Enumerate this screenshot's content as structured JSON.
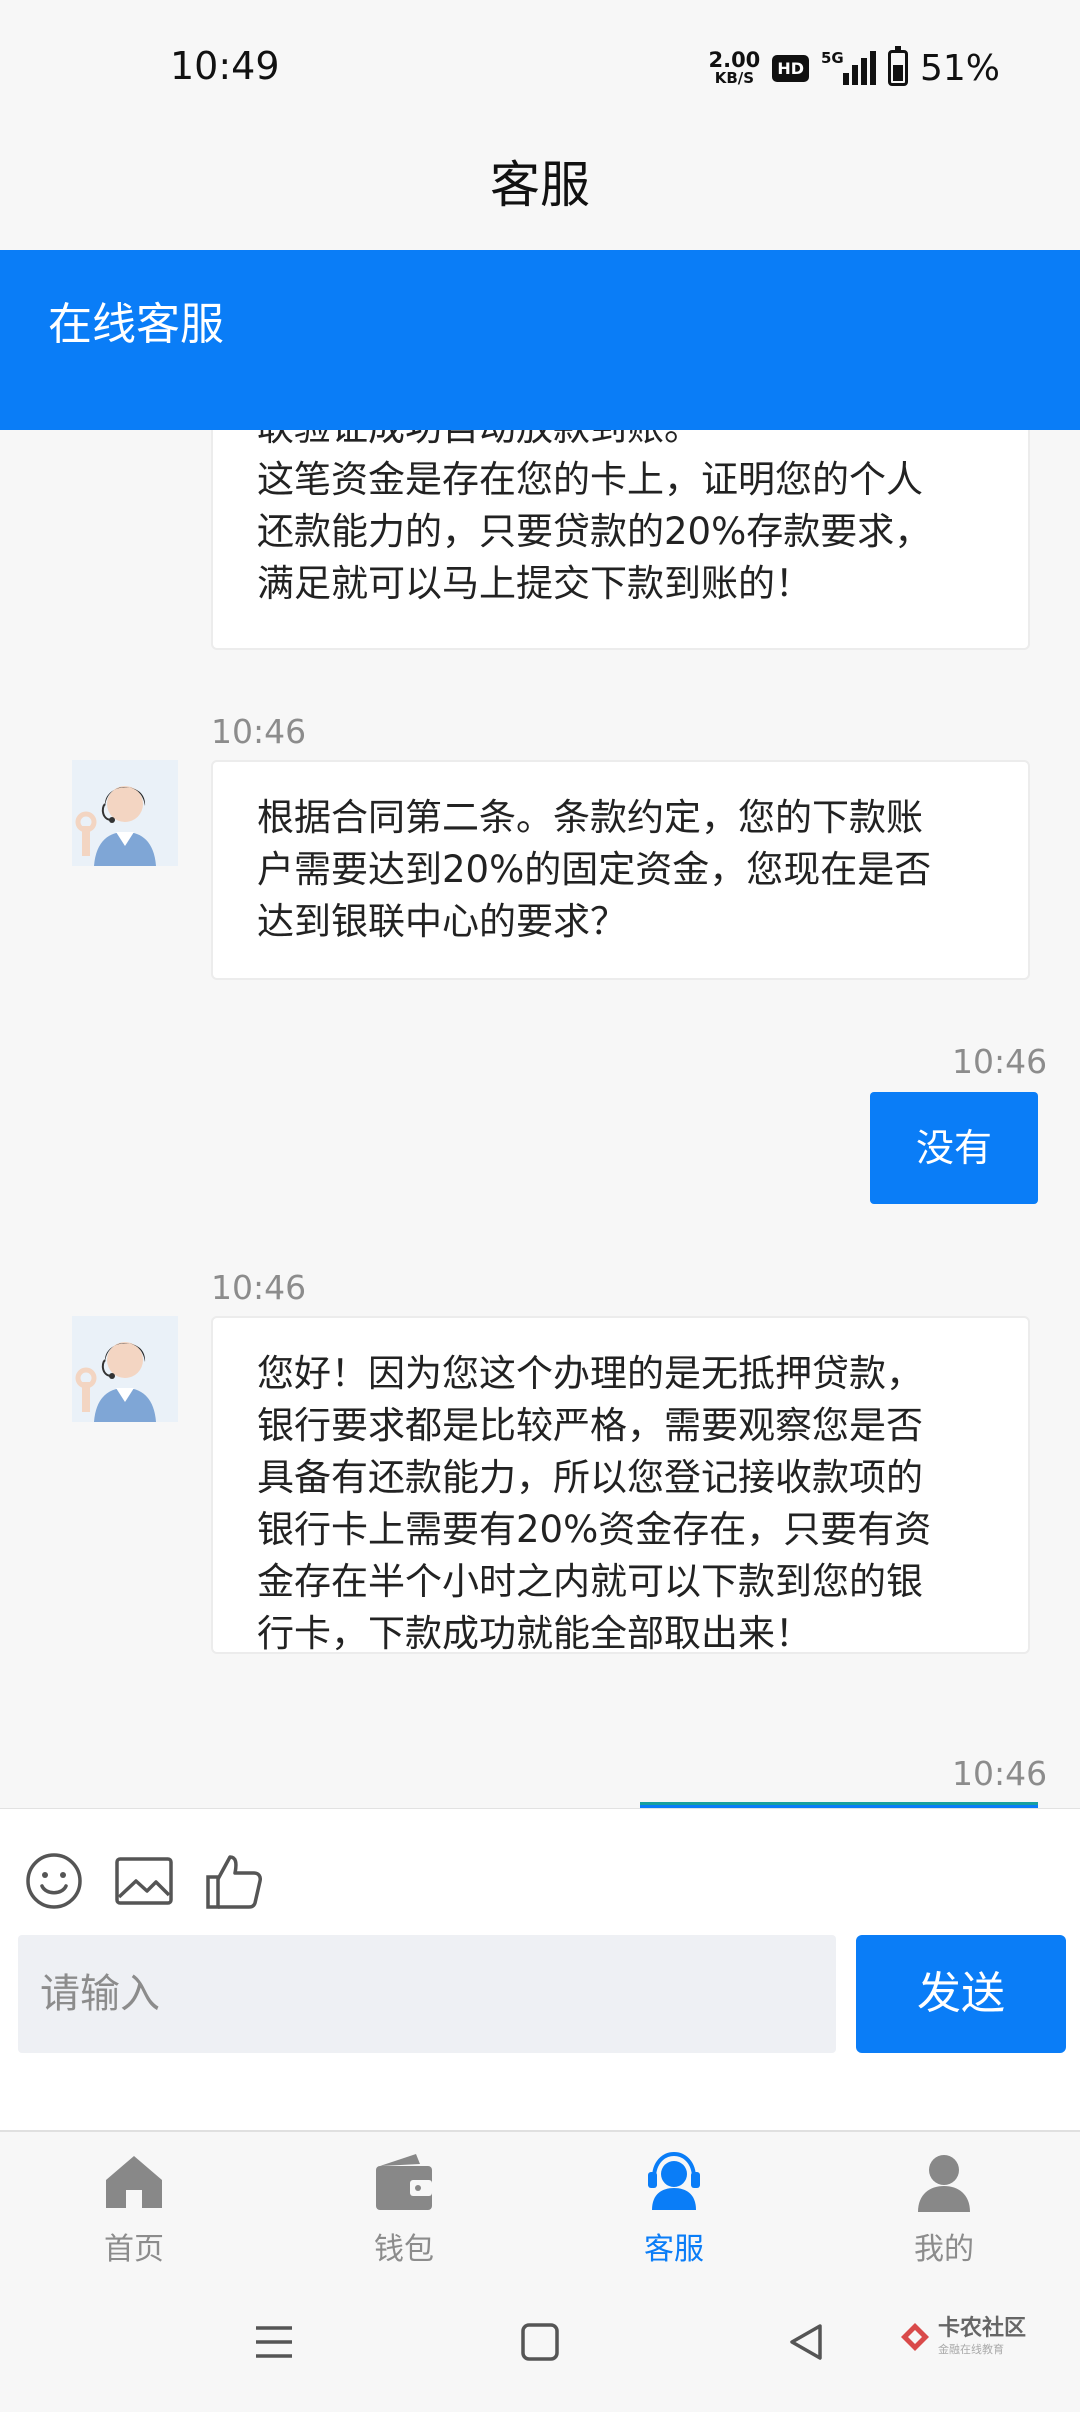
{
  "status_bar": {
    "time": "10:49",
    "net_speed_value": "2.00",
    "net_speed_unit": "KB/S",
    "hd_badge": "HD",
    "network_type": "5G",
    "battery_percent": "51%"
  },
  "header": {
    "title": "客服",
    "banner_text": "在线客服"
  },
  "chat": {
    "messages": [
      {
        "from": "agent",
        "lines": [
          "联验证成功自动放款到账。",
          "这笔资金是存在您的卡上，证明您的个人",
          "还款能力的，只要贷款的20%存款要求，",
          "满足就可以马上提交下款到账的！"
        ]
      },
      {
        "from": "agent",
        "time": "10:46",
        "lines": [
          "根据合同第二条。条款约定，您的下款账",
          "户需要达到20%的固定资金，您现在是否",
          "达到银联中心的要求？"
        ]
      },
      {
        "from": "user",
        "time": "10:46",
        "text": "没有"
      },
      {
        "from": "agent",
        "time": "10:46",
        "lines": [
          "您好！因为您这个办理的是无抵押贷款，",
          "银行要求都是比较严格，需要观察您是否",
          "具备有还款能力，所以您登记接收款项的",
          "银行卡上需要有20%资金存在，只要有资",
          "金存在半个小时之内就可以下款到您的银",
          "行卡，下款成功就能全部取出来！"
        ]
      },
      {
        "from": "user",
        "time": "10:46"
      }
    ]
  },
  "input": {
    "placeholder": "请输入",
    "send_label": "发送",
    "tools": [
      "emoji-icon",
      "image-icon",
      "thumbs-up-icon"
    ]
  },
  "bottom_nav": {
    "items": [
      {
        "label": "首页",
        "icon": "home-icon",
        "active": false
      },
      {
        "label": "钱包",
        "icon": "wallet-icon",
        "active": false
      },
      {
        "label": "客服",
        "icon": "headset-icon",
        "active": true
      },
      {
        "label": "我的",
        "icon": "profile-icon",
        "active": false
      }
    ]
  },
  "watermark": {
    "main": "卡农社区",
    "sub": "金融在线教育"
  },
  "colors": {
    "accent": "#0a7df7",
    "background": "#f7f7f7",
    "inactive_nav": "#8c8c8c",
    "timestamp": "#8c8c8c"
  }
}
